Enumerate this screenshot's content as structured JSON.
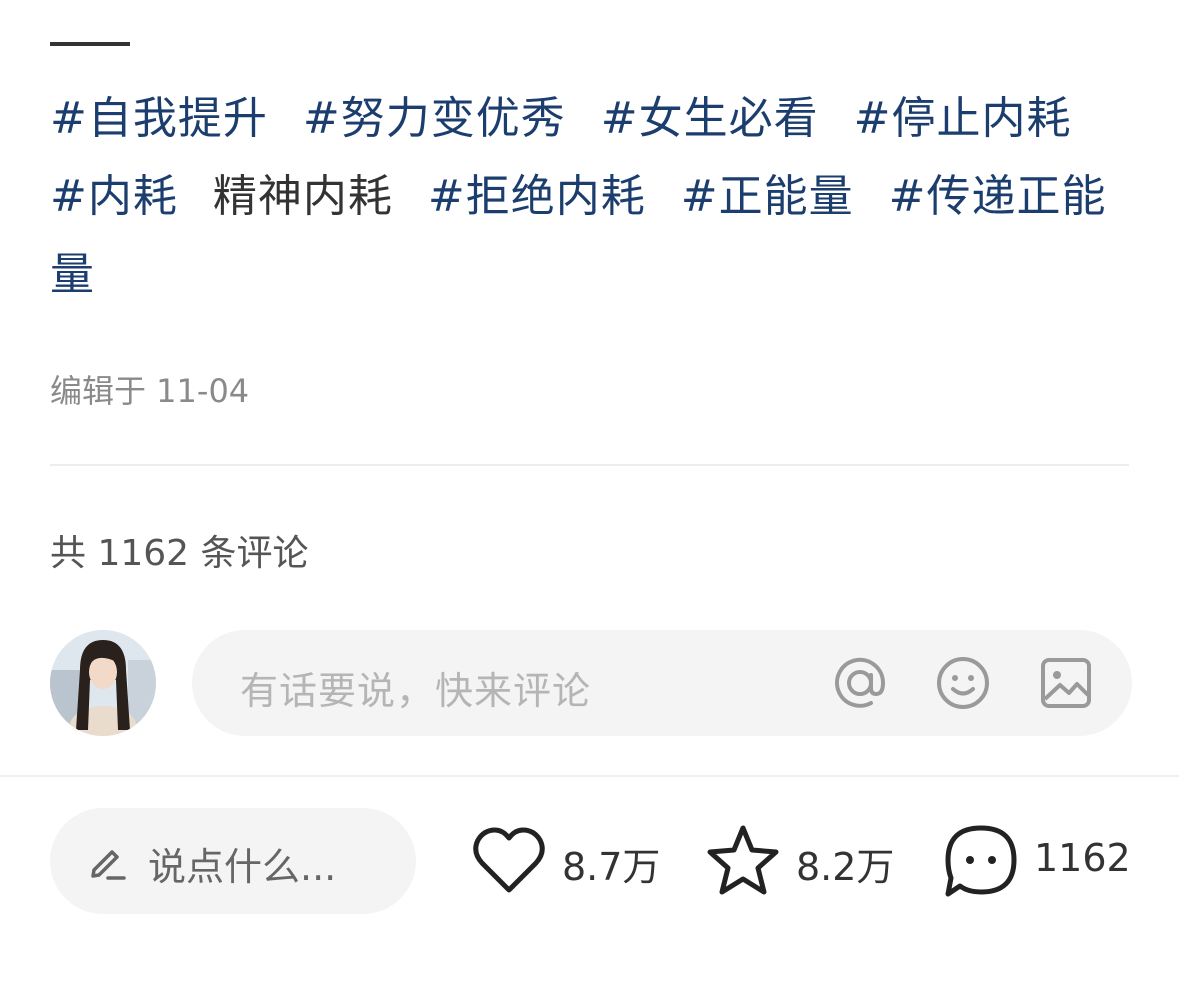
{
  "tags": [
    {
      "text": "#自我提升",
      "link": true
    },
    {
      "text": "#努力变优秀",
      "link": true
    },
    {
      "text": "#女生必看",
      "link": true
    },
    {
      "text": "#停止内耗",
      "link": true
    },
    {
      "text": "#内耗",
      "link": true
    },
    {
      "text": "精神内耗",
      "link": false
    },
    {
      "text": "#拒绝内耗",
      "link": true
    },
    {
      "text": "#正能量",
      "link": true
    },
    {
      "text": "#传递正能量",
      "link": true
    }
  ],
  "post": {
    "edit_time": "编辑于 11-04"
  },
  "comments": {
    "total_label": "共 1162 条评论",
    "input_placeholder": "有话要说，快来评论",
    "icons": [
      "at-icon",
      "emoji-icon",
      "image-icon"
    ]
  },
  "bottom_bar": {
    "say_label": "说点什么...",
    "likes": "8.7万",
    "collects": "8.2万",
    "comments": "1162"
  },
  "colors": {
    "tag_link": "#1c3e6e",
    "muted_text": "#8a8a8a",
    "input_bg": "#f4f4f5"
  }
}
